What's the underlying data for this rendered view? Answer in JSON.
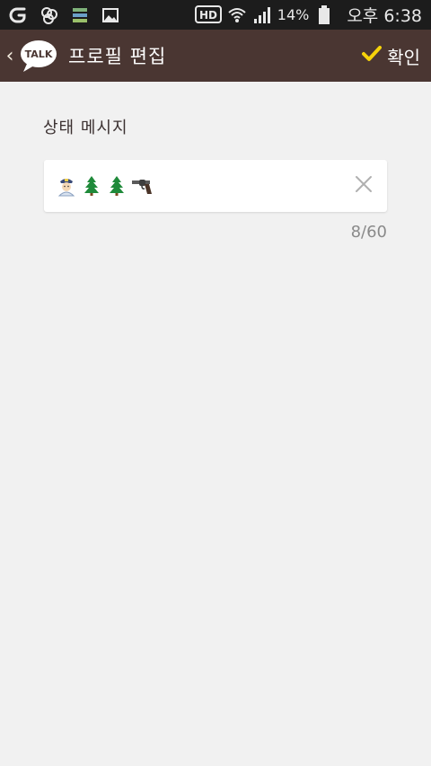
{
  "status_bar": {
    "hd_label": "HD",
    "battery_text": "14%",
    "time": "오후 6:38",
    "icons": [
      "notification-g-icon",
      "app-icon",
      "storage-icon",
      "gallery-icon",
      "hd-icon",
      "wifi-icon",
      "signal-icon",
      "battery-icon"
    ]
  },
  "action_bar": {
    "title": "프로필 편집",
    "logo_text": "TALK",
    "confirm_label": "확인",
    "colors": {
      "background": "#4a3632",
      "check": "#f5d20a"
    }
  },
  "form": {
    "section_label": "상태 메시지",
    "status_message_value": "👮🌲🌲🔫",
    "status_message_emojis": [
      "police-officer-icon",
      "tree-icon",
      "tree-icon",
      "revolver-icon"
    ],
    "char_count": "8/60"
  }
}
